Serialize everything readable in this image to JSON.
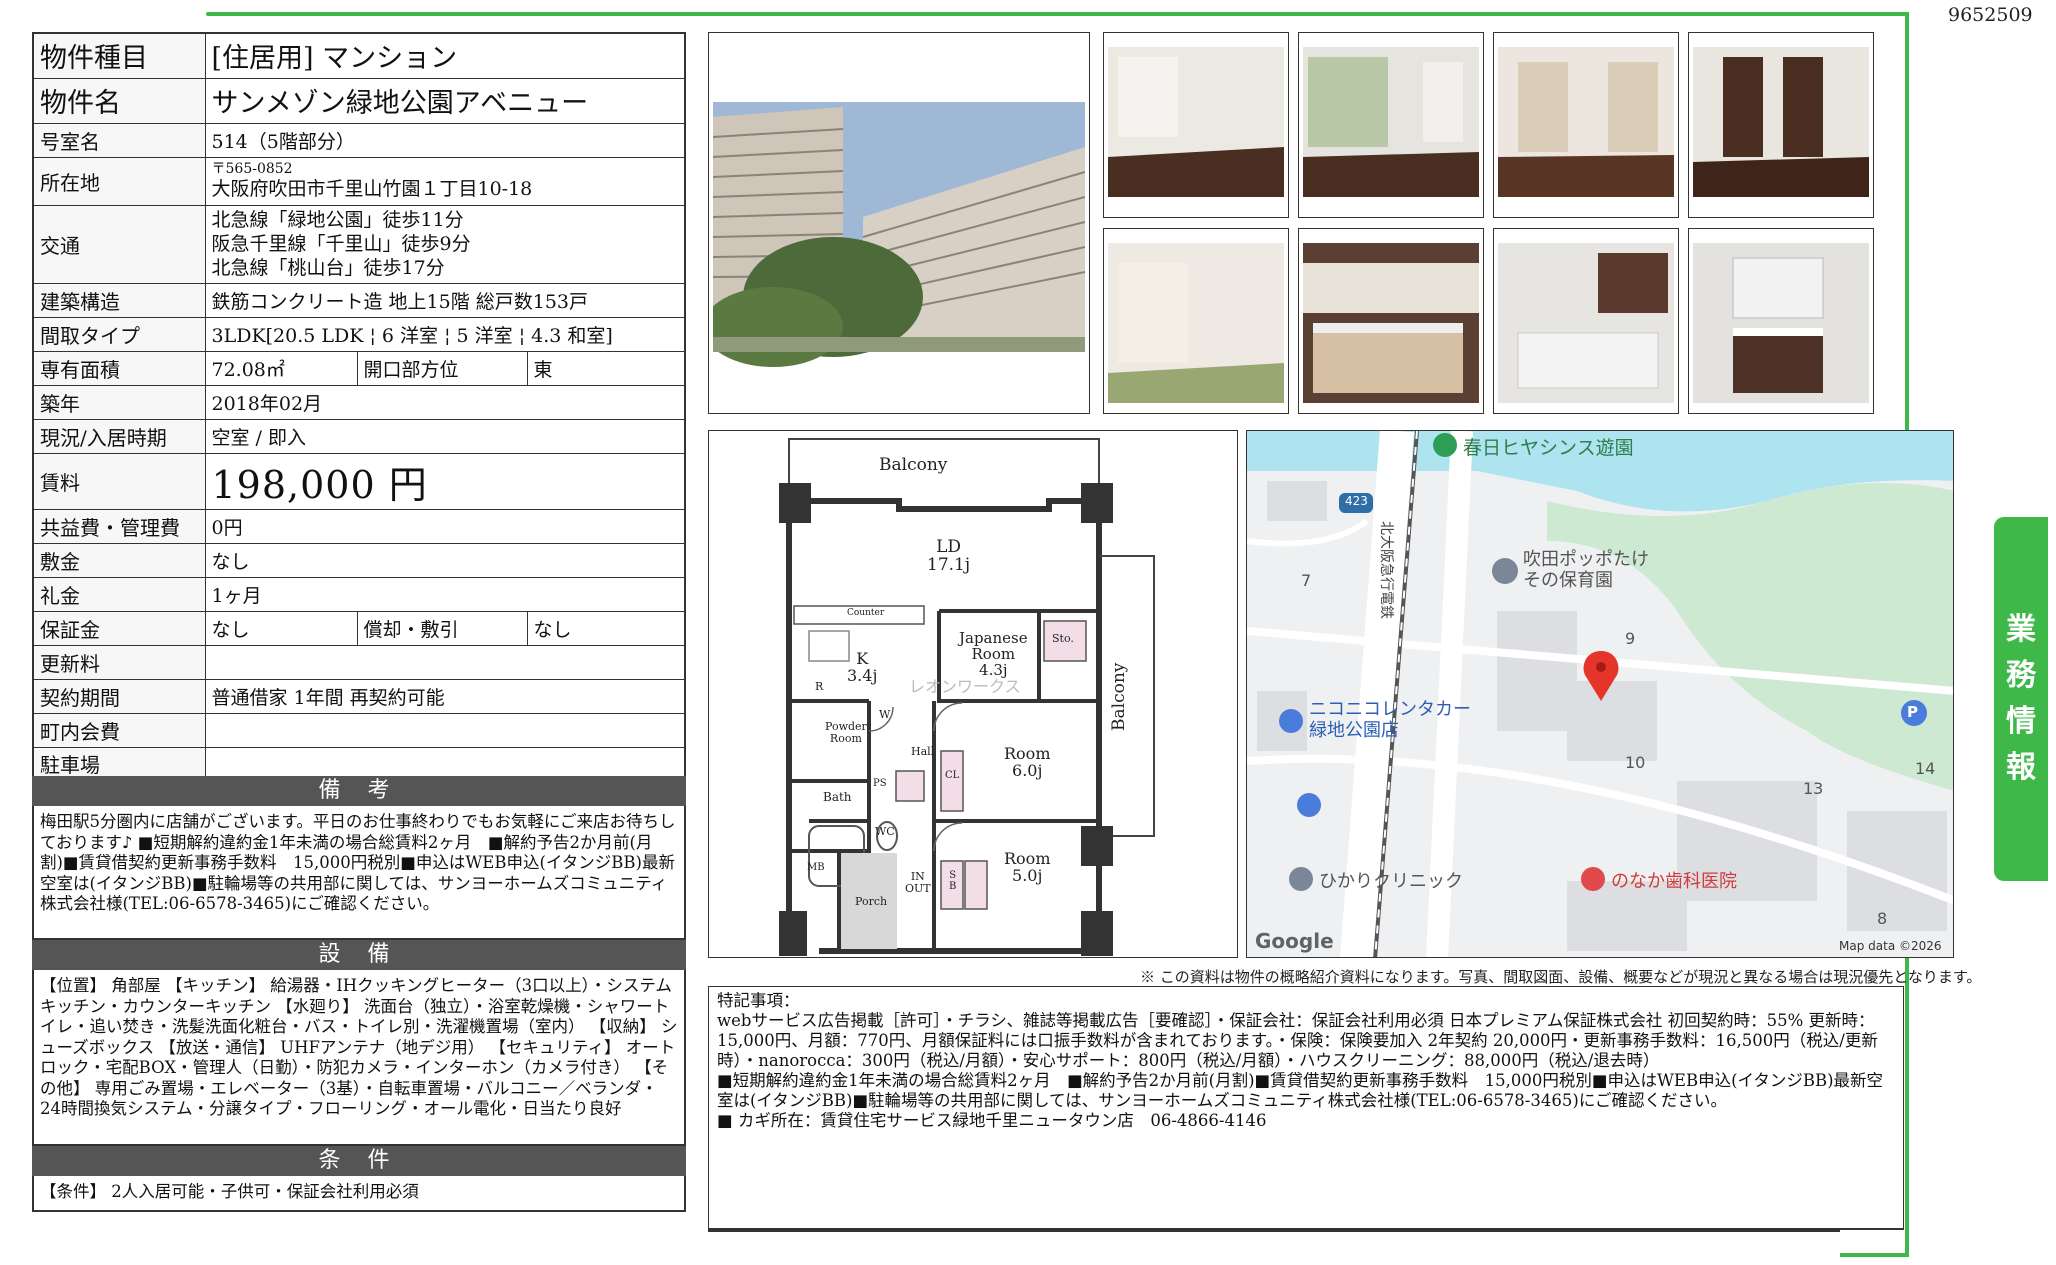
{
  "doc_id": "9652509",
  "side_tab": [
    "業",
    "務",
    "情",
    "報"
  ],
  "info": {
    "type_label": "物件種目",
    "type_value": "[住居用] マンション",
    "name_label": "物件名",
    "name_value": "サンメゾン緑地公園アベニュー",
    "room_label": "号室名",
    "room_value": "514（5階部分）",
    "address_label": "所在地",
    "postal": "〒565-0852",
    "address": "大阪府吹田市千里山竹園１丁目10-18",
    "access_label": "交通",
    "access": [
      "北急線「緑地公園」徒歩11分",
      "阪急千里線「千里山」徒歩9分",
      "北急線「桃山台」徒歩17分"
    ],
    "structure_label": "建築構造",
    "structure_value": "鉄筋コンクリート造 地上15階 総戸数153戸",
    "layout_label": "間取タイプ",
    "layout_value": "3LDK[20.5 LDK ¦ 6 洋室 ¦ 5 洋室 ¦ 4.3 和室]",
    "area_label": "専有面積",
    "area_value": "72.08㎡",
    "direction_label": "開口部方位",
    "direction_value": "東",
    "built_label": "築年",
    "built_value": "2018年02月",
    "status_label": "現況/入居時期",
    "status_value": "空室 / 即入",
    "rent_label": "賃料",
    "rent_value": "198,000 円",
    "common_label": "共益費・管理費",
    "common_value": "0円",
    "deposit_label": "敷金",
    "deposit_value": "なし",
    "key_money_label": "礼金",
    "key_money_value": "1ヶ月",
    "guarantee_label": "保証金",
    "guarantee_value": "なし",
    "amort_label": "償却・敷引",
    "amort_value": "なし",
    "renewal_label": "更新料",
    "renewal_value": "",
    "contract_label": "契約期間",
    "contract_value": "普通借家 1年間 再契約可能",
    "association_label": "町内会費",
    "association_value": "",
    "parking_label": "駐車場",
    "parking_value": ""
  },
  "sections": {
    "remarks_title": "備 考",
    "remarks_text": "梅田駅5分圏内に店舗がございます。平日のお仕事終わりでもお気軽にご来店お待ちしております♪\n■短期解約違約金1年未満の場合総賃料2ヶ月　■解約予告2か月前(月割)■賃貸借契約更新事務手数料　15,000円税別■申込はWEB申込(イタンジBB)最新空室は(イタンジBB)■駐輪場等の共用部に関しては、サンヨーホームズコミュニティ株式会社様(TEL:06-6578-3465)にご確認ください。",
    "equipment_title": "設 備",
    "equipment_text": "【位置】 角部屋 【キッチン】 給湯器・IHクッキングヒーター（3口以上）・システムキッチン・カウンターキッチン 【水廻り】 洗面台（独立）・浴室乾燥機・シャワートイレ・追い焚き・洗髪洗面化粧台・バス・トイレ別・洗濯機置場（室内） 【収納】 シューズボックス 【放送・通信】 UHFアンテナ（地デジ用） 【セキュリティ】 オートロック・宅配BOX・管理人（日勤）・防犯カメラ・インターホン（カメラ付き） 【その他】 専用ごみ置場・エレベーター（3基）・自転車置場・バルコニー／ベランダ・24時間換気システム・分譲タイプ・フローリング・オール電化・日当たり良好",
    "conditions_title": "条 件",
    "conditions_text": "【条件】 2人入居可能・子供可・保証会社利用必須"
  },
  "floor_plan": {
    "balcony_top": "Balcony",
    "balcony_right": "Balcony",
    "ld": "LD\n17.1j",
    "kitchen": "K\n3.4j",
    "counter": "Counter",
    "japanese_room": "Japanese\nRoom\n4.3j",
    "storage": "Sto.",
    "room6": "Room\n6.0j",
    "room5": "Room\n5.0j",
    "powder_room": "Powder\nRoom",
    "bath": "Bath",
    "wc": "WC",
    "hall": "Hall",
    "porch": "Porch",
    "in_out": "IN\nOUT",
    "mb": "MB",
    "ps": "PS",
    "w": "W",
    "r": "R",
    "sb": "S\nB",
    "cl": "CL",
    "watermark": "レオンワークス"
  },
  "map": {
    "park_label": "春日ヒヤシンス遊園",
    "nursery_label": "吹田ポッポたけ\nその保育園",
    "rental_label": "ニコニコレンタカー\n緑地公園店",
    "clinic_label": "ひかりクリニック",
    "dental_label": "のなか歯科医院",
    "railway_label": "北大阪急行電鉄",
    "route_number": "423",
    "numbers": [
      "7",
      "9",
      "10",
      "13",
      "14",
      "8"
    ],
    "parking_icon": "P",
    "google": "Google",
    "map_data": "Map data ©2026"
  },
  "note": "※ この資料は物件の概略紹介資料になります。写真、間取図面、設備、概要などが現況と異なる場合は現況優先となります。",
  "remarks": {
    "title": "特記事項：",
    "lines": [
      "webサービス広告掲載［許可］・チラシ、雑誌等掲載広告［要確認］・保証会社：保証会社利用必須 日本プレミアム保証株式会社 初回契約時：55% 更新時：15,000円、月額：770円、月額保証料には口振手数料が含まれております。・保険：保険要加入 2年契約 20,000円・更新事務手数料：16,500円（税込/更新時）・nanorocca：300円（税込/月額）・安心サポート：800円（税込/月額）・ハウスクリーニング：88,000円（税込/退去時）",
      "■短期解約違約金1年未満の場合総賃料2ヶ月　■解約予告2か月前(月割)■賃貸借契約更新事務手数料　15,000円税別■申込はWEB申込(イタンジBB)最新空室は(イタンジBB)■駐輪場等の共用部に関しては、サンヨーホームズコミュニティ株式会社様(TEL:06-6578-3465)にご確認ください。",
      "■ カギ所在：賃貸住宅サービス緑地千里ニュータウン店　06-4866-4146"
    ]
  },
  "colors": {
    "accent_green": "#3fb84a",
    "section_bar": "#555555"
  }
}
